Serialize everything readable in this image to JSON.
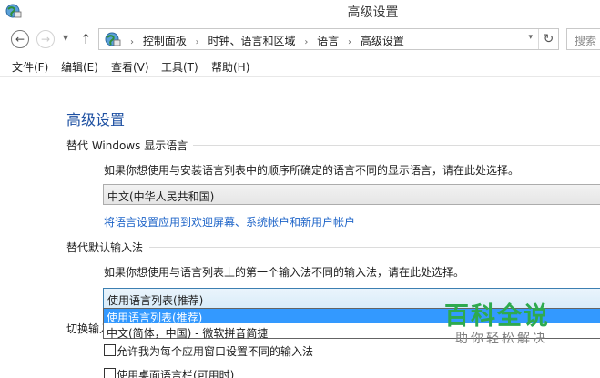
{
  "window": {
    "title": "高级设置"
  },
  "nav": {
    "back_glyph": "←",
    "forward_glyph": "→",
    "recent_glyph": "▼",
    "up_glyph": "↑",
    "address": {
      "crumbs": [
        "控制面板",
        "时钟、语言和区域",
        "语言",
        "高级设置"
      ],
      "separator": "›",
      "dropdown_glyph": "▾",
      "refresh_glyph": "↻"
    },
    "search": {
      "placeholder": "搜索"
    }
  },
  "menu": {
    "items": [
      "文件(F)",
      "编辑(E)",
      "查看(V)",
      "工具(T)",
      "帮助(H)"
    ]
  },
  "main": {
    "title": "高级设置",
    "display_language": {
      "heading": "替代 Windows 显示语言",
      "description": "如果你想使用与安装语言列表中的顺序所确定的语言不同的显示语言，请在此处选择。",
      "selected": "中文(中华人民共和国)",
      "link": "将语言设置应用到欢迎屏幕、系统帐户和新用户帐户"
    },
    "input_method": {
      "heading": "替代默认输入法",
      "description": "如果你想使用与语言列表上的第一个输入法不同的输入法，请在此处选择。",
      "selected": "使用语言列表(推荐)",
      "options": [
        "使用语言列表(推荐)",
        "中文(简体，中国) - 微软拼音简捷"
      ]
    },
    "switch_input": {
      "heading": "切换输入",
      "options": [
        "允许我为每个应用窗口设置不同的输入法",
        "使用桌面语言栏(可用时)"
      ]
    }
  },
  "watermark": {
    "main": "百科全说",
    "sub": "助你轻松解决"
  },
  "colors": {
    "title_blue": "#1e50a2",
    "link_blue": "#1e64c8",
    "selection_blue": "#3399ff",
    "watermark_green": "#2eaa4f"
  },
  "icons": {
    "app": "control-panel-globe-icon",
    "back": "back-arrow-icon",
    "forward": "forward-arrow-icon",
    "up": "up-arrow-icon",
    "refresh": "refresh-icon"
  }
}
